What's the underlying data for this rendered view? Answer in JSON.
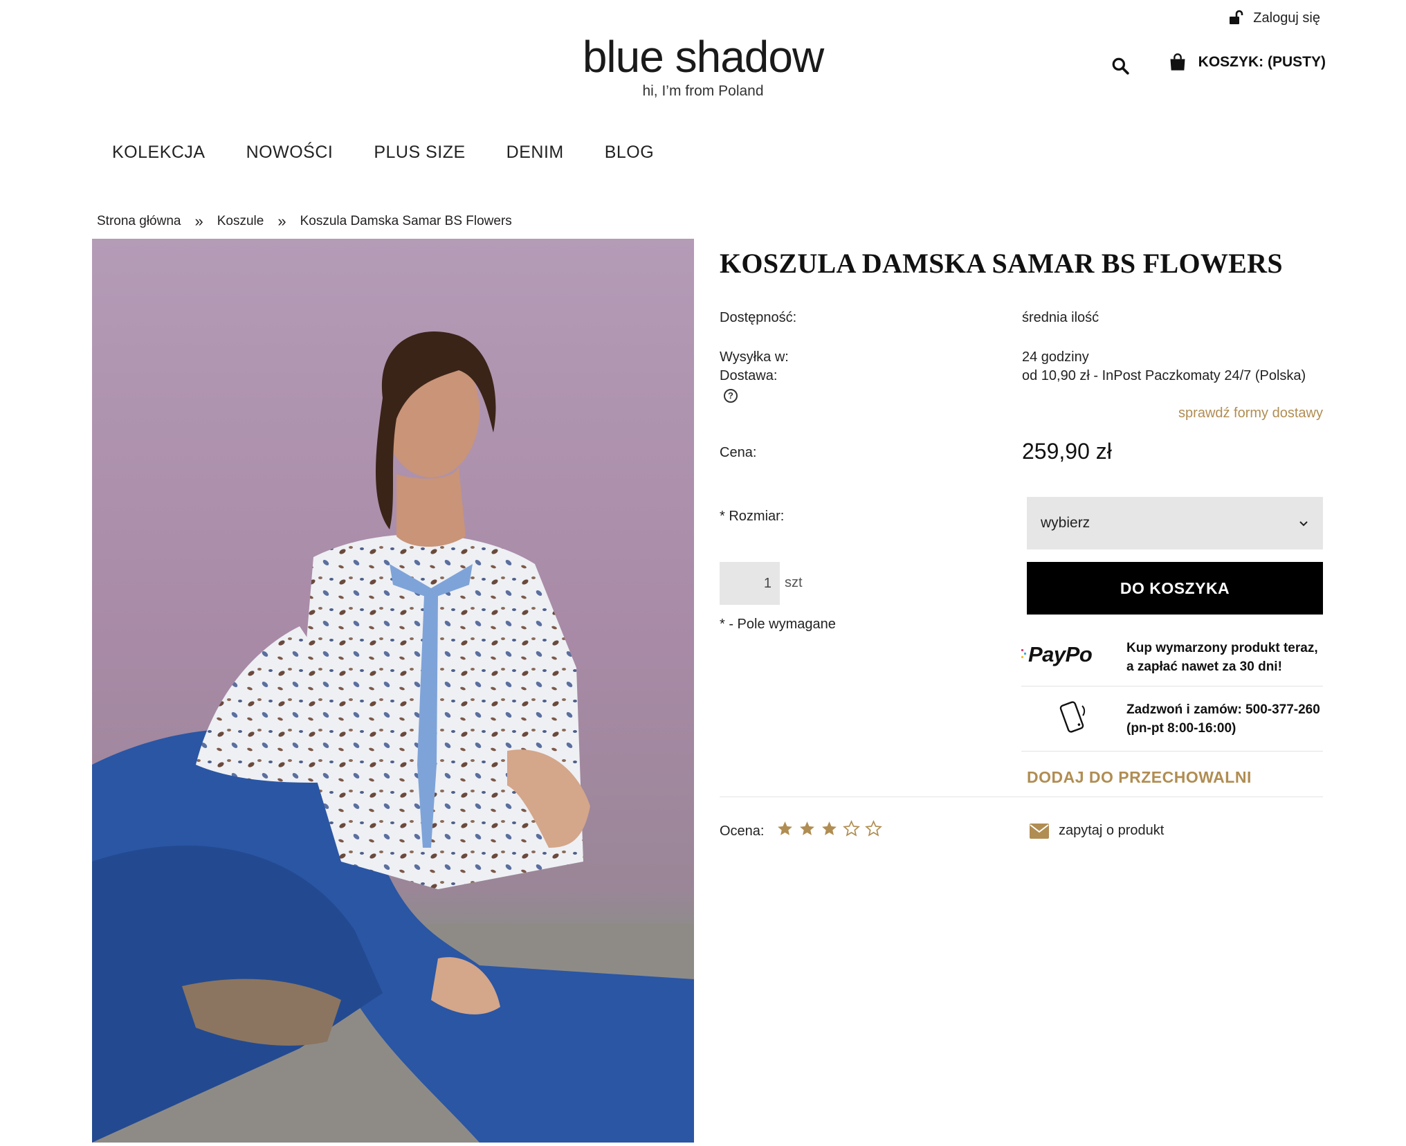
{
  "header": {
    "login_label": "Zaloguj się",
    "logo_text": "blue shadow",
    "logo_tagline": "hi, I’m from Poland",
    "cart_label": "KOSZYK: (PUSTY)"
  },
  "nav": {
    "items": [
      {
        "label": "KOLEKCJA"
      },
      {
        "label": "NOWOŚCI"
      },
      {
        "label": "PLUS SIZE"
      },
      {
        "label": "DENIM"
      },
      {
        "label": "BLOG"
      }
    ]
  },
  "breadcrumb": {
    "items": [
      "Strona główna",
      "Koszule",
      "Koszula Damska Samar BS Flowers"
    ],
    "separator": "»"
  },
  "product": {
    "title": "KOSZULA DAMSKA SAMAR BS FLOWERS",
    "availability_label": "Dostępność:",
    "availability_value": "średnia ilość",
    "shipping_label": "Wysyłka w:",
    "shipping_value": "24 godziny",
    "delivery_label": "Dostawa:",
    "delivery_value": "od 10,90 zł - InPost Paczkomaty 24/7 (Polska)",
    "delivery_link": "sprawdź formy dostawy",
    "price_label": "Cena:",
    "price_value": "259,90 zł",
    "size_label": "* Rozmiar:",
    "size_selected": "wybierz",
    "quantity_value": "1",
    "quantity_unit": "szt",
    "required_note": "* - Pole wymagane",
    "add_to_cart": "DO KOSZYKA",
    "paypo_logo": "PayPo",
    "paypo_text_1": "Kup wymarzony produkt teraz,",
    "paypo_text_2": "a zapłać nawet za 30 dni!",
    "phone_text_1": "Zadzwoń i zamów: 500-377-260",
    "phone_text_2": "(pn-pt 8:00-16:00)",
    "store_label": "DODAJ DO PRZECHOWALNI",
    "rating_label": "Ocena:",
    "rating": {
      "value": 3,
      "max": 5
    },
    "ask_label": "zapytaj o produkt"
  },
  "colors": {
    "accent_gold": "#b08d52",
    "button_black": "#000000",
    "select_bg": "#e6e6e6"
  },
  "icons": {
    "login": "unlock-icon",
    "search": "search-icon",
    "cart": "shopping-bag-icon",
    "help": "question-circle-icon",
    "dropdown": "chevron-down-icon",
    "phone": "smartphone-icon",
    "star": "star-icon",
    "mail": "envelope-icon"
  }
}
